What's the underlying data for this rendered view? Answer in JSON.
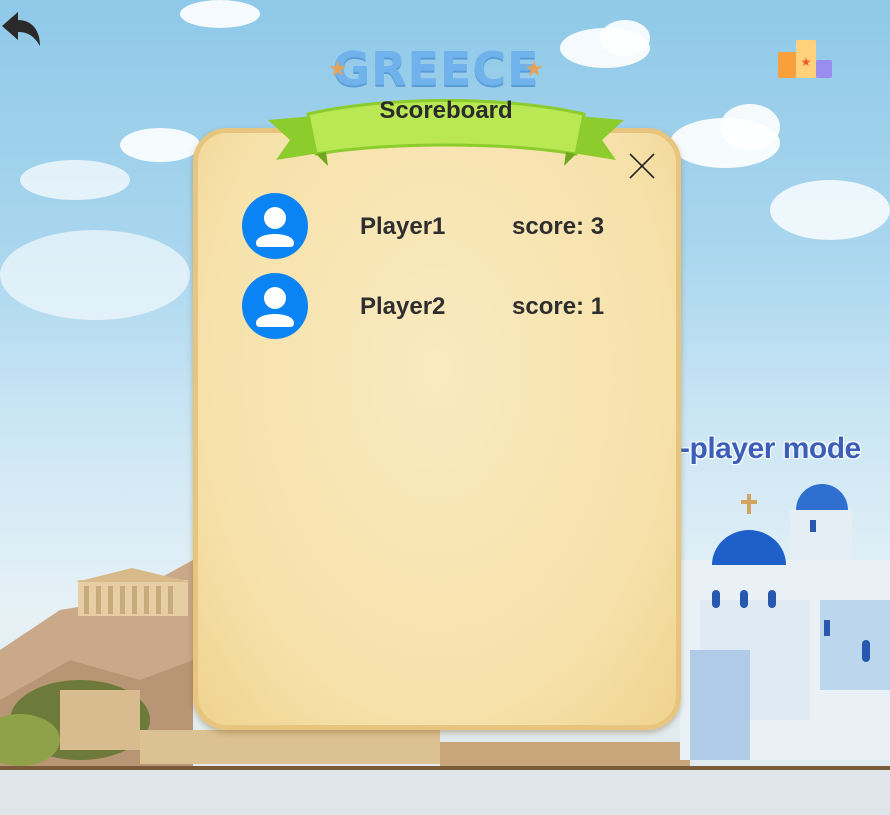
{
  "header": {
    "title": "GREECE",
    "back_icon": "back-arrow-icon",
    "leaderboard_icon": "podium-icon"
  },
  "mode": {
    "label": "-player mode"
  },
  "scoreboard": {
    "title": "Scoreboard",
    "close_icon": "close-icon",
    "players": [
      {
        "name": "Player1",
        "score": "score: 3",
        "avatar_icon": "user-avatar-icon"
      },
      {
        "name": "Player2",
        "score": "score: 1",
        "avatar_icon": "user-avatar-icon"
      }
    ]
  },
  "colors": {
    "avatar": "#0a84f4",
    "ribbon": "#9fdc3a",
    "panel": "#f6e1a9",
    "title": "#6fb2ec",
    "mode_label": "#3b5fb8"
  }
}
